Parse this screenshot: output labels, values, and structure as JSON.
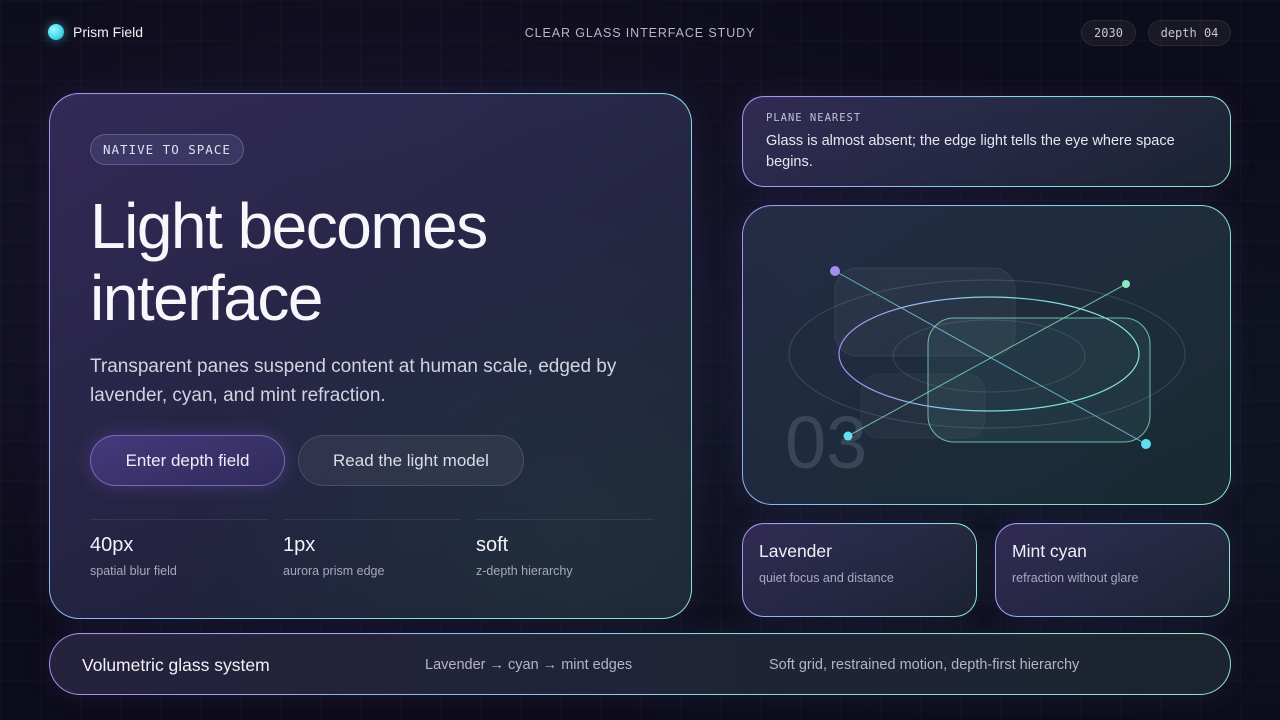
{
  "header": {
    "brand": "Prism Field",
    "study_title": "CLEAR GLASS INTERFACE STUDY",
    "year_chip": "2030",
    "depth_chip": "depth 04"
  },
  "hero": {
    "badge": "NATIVE TO SPACE",
    "title": "Light becomes interface",
    "description": "Transparent panes suspend content at human scale, edged by lavender, cyan, and mint refraction.",
    "primary_button": "Enter depth field",
    "secondary_button": "Read the light model",
    "stats": [
      {
        "value": "40px",
        "label": "spatial blur field"
      },
      {
        "value": "1px",
        "label": "aurora prism edge"
      },
      {
        "value": "soft",
        "label": "z-depth hierarchy"
      }
    ]
  },
  "nearest": {
    "kicker": "PLANE NEAREST",
    "text": "Glass is almost absent; the edge light tells the eye where space begins."
  },
  "visual": {
    "index": "03"
  },
  "swatches": [
    {
      "title": "Lavender",
      "desc": "quiet focus and distance"
    },
    {
      "title": "Mint cyan",
      "desc": "refraction without glare"
    }
  ],
  "footer": {
    "title": "Volumetric glass system",
    "edges": "Lavender → cyan → mint edges",
    "principles": "Soft grid, restrained motion, depth-first hierarchy"
  },
  "colors": {
    "lavender": "#a58ff0",
    "cyan": "#7fd8e8",
    "mint": "#8be8c4",
    "background": "#0d0c1a"
  },
  "icons": {
    "brand": "prism-dot-icon"
  }
}
